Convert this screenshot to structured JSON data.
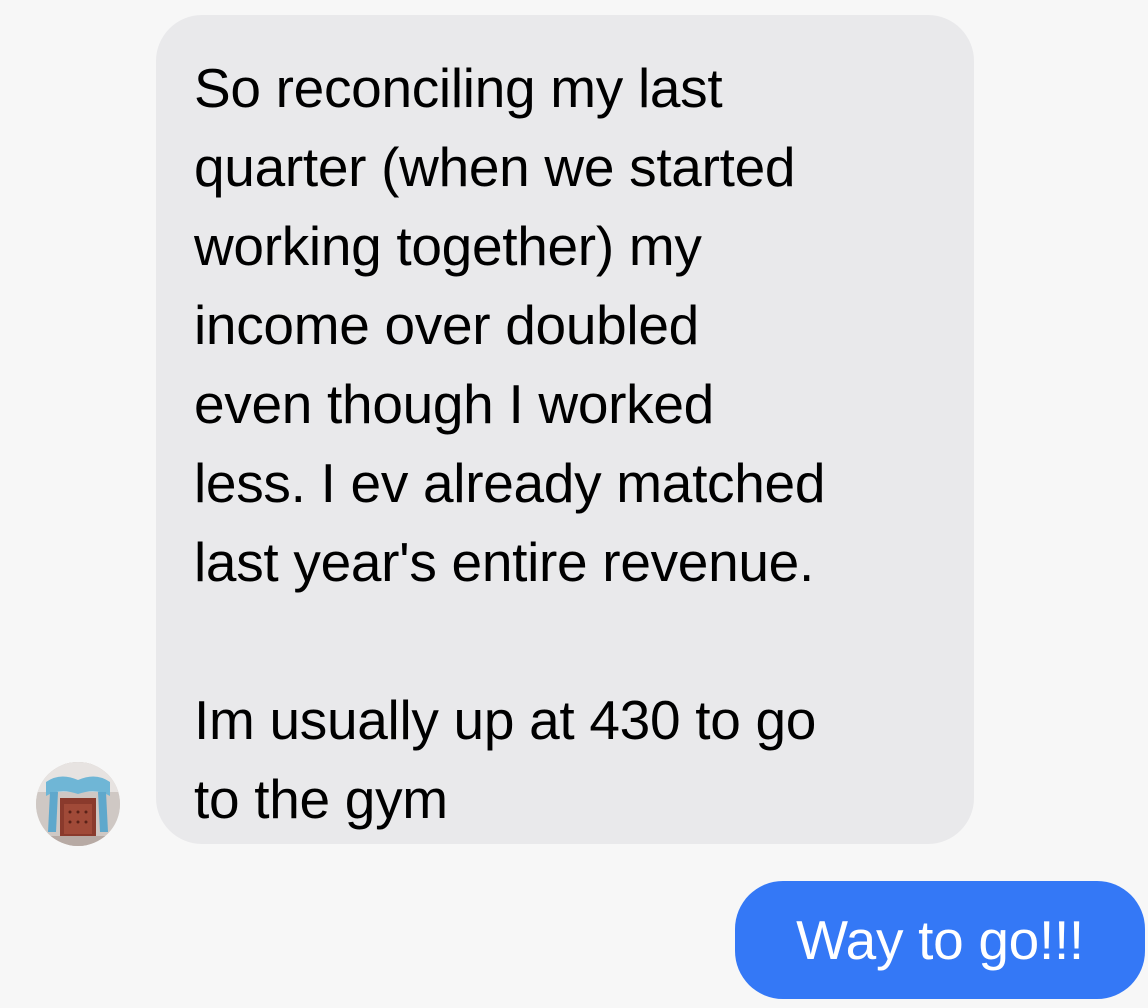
{
  "messages": {
    "incoming": {
      "text": "So reconciling my last\nquarter (when we started\nworking together) my\nincome over doubled\neven though I worked\nless. I ev already matched\nlast year's entire revenue.\n\nIm usually up at 430 to go\nto the gym",
      "bubble_color": "#e9e9eb",
      "text_color": "#000000"
    },
    "outgoing": {
      "text": "Way to go!!!",
      "bubble_color": "#3478f6",
      "text_color": "#ffffff"
    }
  },
  "contact": {
    "avatar_icon": "contact-avatar-photo"
  },
  "colors": {
    "background": "#f7f7f7"
  }
}
